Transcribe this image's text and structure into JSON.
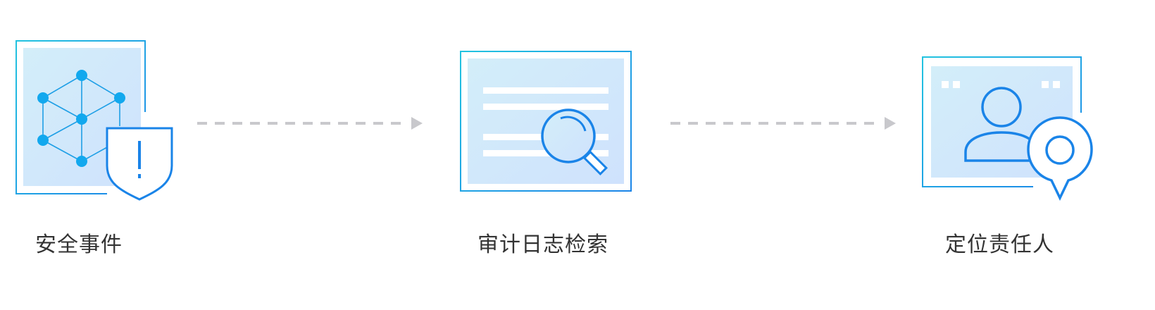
{
  "colors": {
    "primary_blue": "#1a84e8",
    "cyan_stroke": "#22c3e0",
    "panel_fill_start": "#d3eef9",
    "panel_fill_end": "#cfe2fd",
    "node_blue": "#12a8ee",
    "arrow_gray": "#c8c8cc",
    "label_text": "#333333"
  },
  "steps": [
    {
      "label": "安全事件",
      "icon": "security-cube-shield-icon"
    },
    {
      "label": "审计日志检索",
      "icon": "log-search-magnifier-icon"
    },
    {
      "label": "定位责任人",
      "icon": "person-location-pin-icon"
    }
  ],
  "connectors": [
    {
      "from": 1,
      "to": 2,
      "style": "dashed-arrow"
    },
    {
      "from": 2,
      "to": 3,
      "style": "dashed-arrow"
    }
  ]
}
